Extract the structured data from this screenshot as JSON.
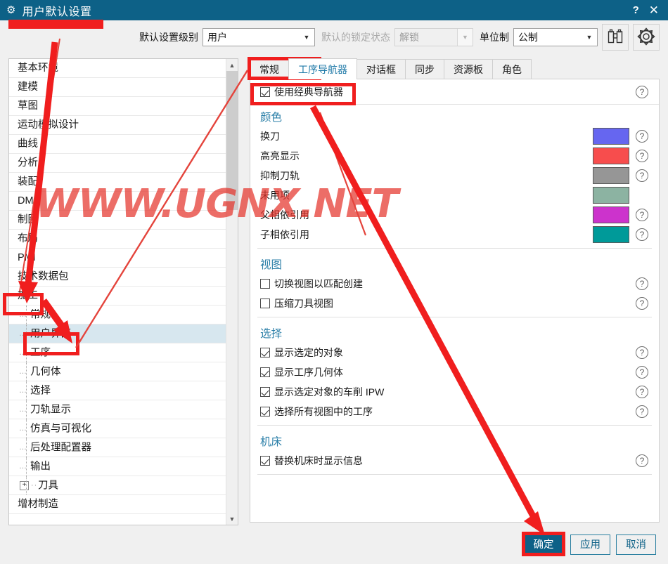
{
  "window": {
    "title": "用户默认设置",
    "gear_icon": "gear-icon",
    "help_btn": "?",
    "close_btn": "✕"
  },
  "toolbar": {
    "level_label": "默认设置级别",
    "level_value": "用户",
    "lock_label": "默认的锁定状态",
    "lock_value": "解锁",
    "units_label": "单位制",
    "units_value": "公制",
    "find_icon": "binoculars-icon",
    "settings_icon": "gear-icon"
  },
  "tree": {
    "items": [
      {
        "label": "基本环境",
        "level": 0,
        "selected": false
      },
      {
        "label": "建模",
        "level": 0,
        "selected": false
      },
      {
        "label": "草图",
        "level": 0,
        "selected": false
      },
      {
        "label": "运动模拟设计",
        "level": 0,
        "selected": false
      },
      {
        "label": "曲线",
        "level": 0,
        "selected": false
      },
      {
        "label": "分析",
        "level": 0,
        "selected": false
      },
      {
        "label": "装配",
        "level": 0,
        "selected": false
      },
      {
        "label": "DMU",
        "level": 0,
        "selected": false
      },
      {
        "label": "制图",
        "level": 0,
        "selected": false
      },
      {
        "label": "布局",
        "level": 0,
        "selected": false
      },
      {
        "label": "PMI",
        "level": 0,
        "selected": false
      },
      {
        "label": "技术数据包",
        "level": 0,
        "selected": false
      },
      {
        "label": "加工",
        "level": 0,
        "selected": false
      },
      {
        "label": "常规",
        "level": 1,
        "selected": false
      },
      {
        "label": "用户界面",
        "level": 1,
        "selected": true
      },
      {
        "label": "工序",
        "level": 1,
        "selected": false
      },
      {
        "label": "几何体",
        "level": 1,
        "selected": false
      },
      {
        "label": "选择",
        "level": 1,
        "selected": false
      },
      {
        "label": "刀轨显示",
        "level": 1,
        "selected": false
      },
      {
        "label": "仿真与可视化",
        "level": 1,
        "selected": false
      },
      {
        "label": "后处理配置器",
        "level": 1,
        "selected": false
      },
      {
        "label": "输出",
        "level": 1,
        "selected": false
      },
      {
        "label": "刀具",
        "level": 1,
        "selected": false,
        "expandable": true
      },
      {
        "label": "增材制造",
        "level": 0,
        "selected": false
      }
    ]
  },
  "tabs": [
    {
      "label": "常规",
      "active": false
    },
    {
      "label": "工序导航器",
      "active": true
    },
    {
      "label": "对话框",
      "active": false
    },
    {
      "label": "同步",
      "active": false
    },
    {
      "label": "资源板",
      "active": false
    },
    {
      "label": "角色",
      "active": false
    }
  ],
  "panel": {
    "classic_nav": {
      "label": "使用经典导航器",
      "checked": true,
      "help": "?"
    },
    "groups": [
      {
        "title": "颜色",
        "type": "color",
        "rows": [
          {
            "label": "换刀",
            "color": "#6666f0",
            "help": "?"
          },
          {
            "label": "高亮显示",
            "color": "#f74d4d",
            "help": "?"
          },
          {
            "label": "抑制刀轨",
            "color": "#969696",
            "help": "?"
          },
          {
            "label": "未用项",
            "color": "#8cb3a2",
            "help": ""
          },
          {
            "label": "父相依引用",
            "color": "#cc33cc",
            "help": "?"
          },
          {
            "label": "子相依引用",
            "color": "#009a99",
            "help": "?"
          }
        ]
      },
      {
        "title": "视图",
        "type": "check",
        "rows": [
          {
            "label": "切换视图以匹配创建",
            "checked": false,
            "help": "?"
          },
          {
            "label": "压缩刀具视图",
            "checked": false,
            "help": "?"
          }
        ]
      },
      {
        "title": "选择",
        "type": "check",
        "rows": [
          {
            "label": "显示选定的对象",
            "checked": true,
            "help": "?"
          },
          {
            "label": "显示工序几何体",
            "checked": true,
            "help": "?"
          },
          {
            "label": "显示选定对象的车削 IPW",
            "checked": true,
            "help": "?"
          },
          {
            "label": "选择所有视图中的工序",
            "checked": true,
            "help": "?"
          }
        ]
      },
      {
        "title": "机床",
        "type": "check",
        "rows": [
          {
            "label": "替换机床时显示信息",
            "checked": true,
            "help": "?"
          }
        ]
      }
    ]
  },
  "footer": {
    "ok": "确定",
    "apply": "应用",
    "cancel": "取消"
  },
  "watermark": {
    "text": "WWW.UGNX.NET",
    "color": "#e4342d"
  },
  "annotation": {
    "color": "#f01e1e"
  }
}
